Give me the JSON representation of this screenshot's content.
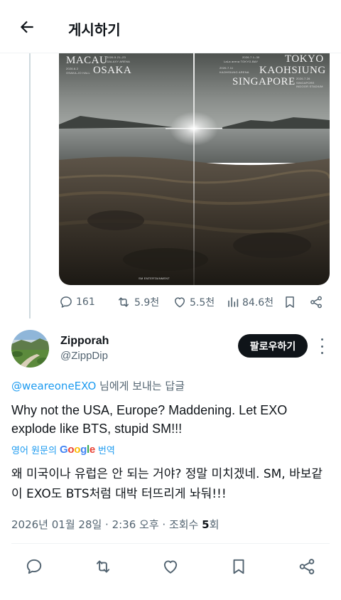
{
  "header": {
    "title": "게시하기"
  },
  "poster": {
    "left_city_1": "MACAU",
    "left_city_1_date": "2026.5.21–23",
    "left_city_1_venue": "GALAXY ARENA",
    "left_city_2": "OSAKA",
    "left_city_2_date": "2026.6.2",
    "left_city_2_venue": "OSAKA-JO HALL",
    "right_city_1": "TOKYO",
    "right_city_1_date": "2026.7.1–30",
    "right_city_1_venue": "LaLa arena TOKYO-BAY",
    "right_city_2": "KAOHSIUNG",
    "right_city_2_date": "2026.7.11",
    "right_city_2_venue": "KAOHSIUNG ARENA",
    "right_city_3": "SINGAPORE",
    "right_city_3_date": "2026.7.26",
    "right_city_3_venue": "SINGAPORE INDOOR STADIUM",
    "logo_text": "SM ENTERTAINMENT"
  },
  "tweet_actions": {
    "replies": "161",
    "reposts": "5.9천",
    "likes": "5.5천",
    "views": "84.6천"
  },
  "reply": {
    "display_name": "Zipporah",
    "handle": "@ZippDip",
    "follow_label": "팔로우하기",
    "reply_to_mention": "@weareoneEXO",
    "reply_to_suffix": " 님에게 보내는 답글",
    "text": "Why not the USA, Europe? Maddening. Let EXO explode like BTS, stupid SM!!!",
    "translate_prefix": "영어 원문의",
    "translate_brand": "Google",
    "translate_suffix": "번역",
    "translated_text": "왜 미국이나 유럽은 안 되는 거야? 정말 미치겠네. SM, 바보같이 EXO도 BTS처럼 대박 터뜨리게 놔둬!!!",
    "timestamp": "2026년 01월 28일 · 2:36 오후 · 조회수 ",
    "views_count": "5",
    "views_unit": "회"
  },
  "colors": {
    "accent": "#1d9bf0",
    "text_primary": "#0f1419",
    "text_secondary": "#536471",
    "follow_bg": "#0f1419"
  },
  "icons": {
    "back": "arrow-left-icon",
    "reply": "speech-bubble-icon",
    "repost": "repost-icon",
    "like": "heart-icon",
    "views": "bar-chart-icon",
    "bookmark": "bookmark-icon",
    "share": "share-icon",
    "more": "vertical-dots-icon"
  }
}
